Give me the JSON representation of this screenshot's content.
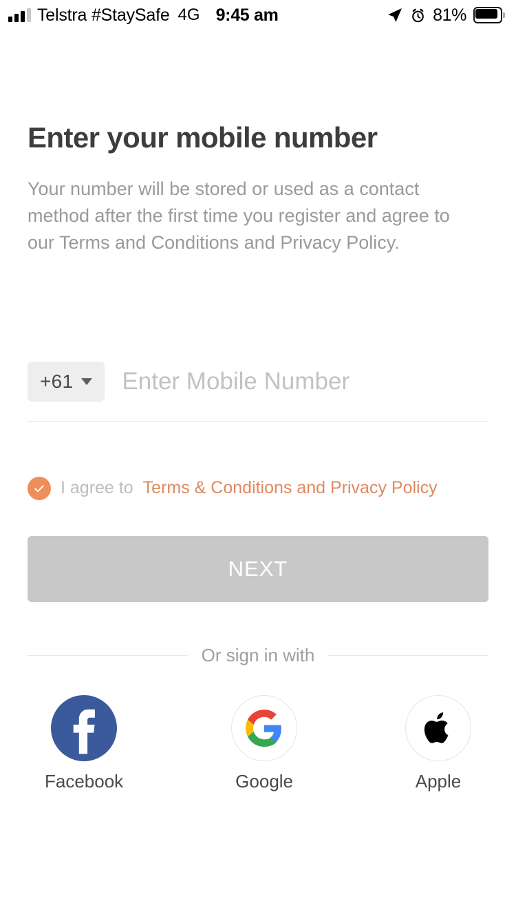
{
  "status_bar": {
    "carrier": "Telstra #StaySafe",
    "network": "4G",
    "time": "9:45 am",
    "battery_percent": "81%",
    "signal_bars_filled": 3,
    "signal_bars_total": 4,
    "icons": [
      "signal-bars-icon",
      "location-arrow-icon",
      "alarm-clock-icon",
      "battery-icon"
    ]
  },
  "page": {
    "title": "Enter your mobile number",
    "subtitle": "Your number will be stored or used as a contact method after the first time you register and agree to our Terms and Conditions and Privacy Policy."
  },
  "phone": {
    "country_code": "+61",
    "placeholder": "Enter Mobile Number",
    "value": ""
  },
  "agree": {
    "checked": true,
    "prefix": "I agree to",
    "link": "Terms & Conditions and Privacy Policy",
    "check_color": "#ef8e5a",
    "link_color": "#e0895e"
  },
  "actions": {
    "next_label": "NEXT",
    "next_enabled": false,
    "next_bg": "#c8c8c8"
  },
  "divider": {
    "label": "Or sign in with"
  },
  "social": [
    {
      "label": "Facebook",
      "icon": "facebook-icon",
      "color": "#3b5a9b"
    },
    {
      "label": "Google",
      "icon": "google-icon",
      "color": "#ffffff"
    },
    {
      "label": "Apple",
      "icon": "apple-icon",
      "color": "#ffffff"
    }
  ]
}
